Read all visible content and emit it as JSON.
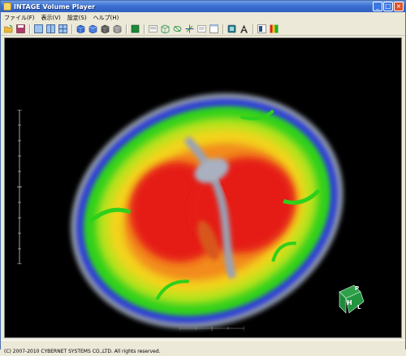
{
  "window": {
    "title": "INTAGE Volume Player",
    "controls": {
      "minimize": "_",
      "maximize": "□",
      "close": "×"
    }
  },
  "menu": [
    {
      "label": "ファイル(F)"
    },
    {
      "label": "表示(V)"
    },
    {
      "label": "設定(S)"
    },
    {
      "label": "ヘルプ(H)"
    }
  ],
  "toolbar": {
    "icons": [
      "open-folder-icon",
      "save-icon",
      "single-view-icon",
      "dual-view-icon",
      "quad-view-icon",
      "cube-blue-icon",
      "cube-solid-icon",
      "cube-dark-icon",
      "cube-gray-icon",
      "render-green-icon",
      "image-display-icon",
      "box-3d-icon",
      "transform-3d-icon",
      "axes-icon",
      "info-icon",
      "window-icon",
      "export-icon",
      "annotate-icon",
      "panel-icon",
      "colormap-icon"
    ]
  },
  "viewport": {
    "orientation": {
      "front": "H",
      "top": "P",
      "side": "L"
    }
  },
  "status": {
    "text": "(C) 2007-2010 CYBERNET SYSTEMS CO.,LTD. All rights reserved."
  },
  "colors": {
    "title_gradient_top": "#6f9ee8",
    "title_gradient_bottom": "#2f5fc1",
    "chrome": "#ece9d8",
    "viewport_bg": "#000000",
    "heat_red": "#e51b14",
    "heat_yellow": "#f3d41a",
    "heat_green": "#2fd01a",
    "heat_blue": "#2d3fd8",
    "cube_green": "#1e8a3a"
  }
}
